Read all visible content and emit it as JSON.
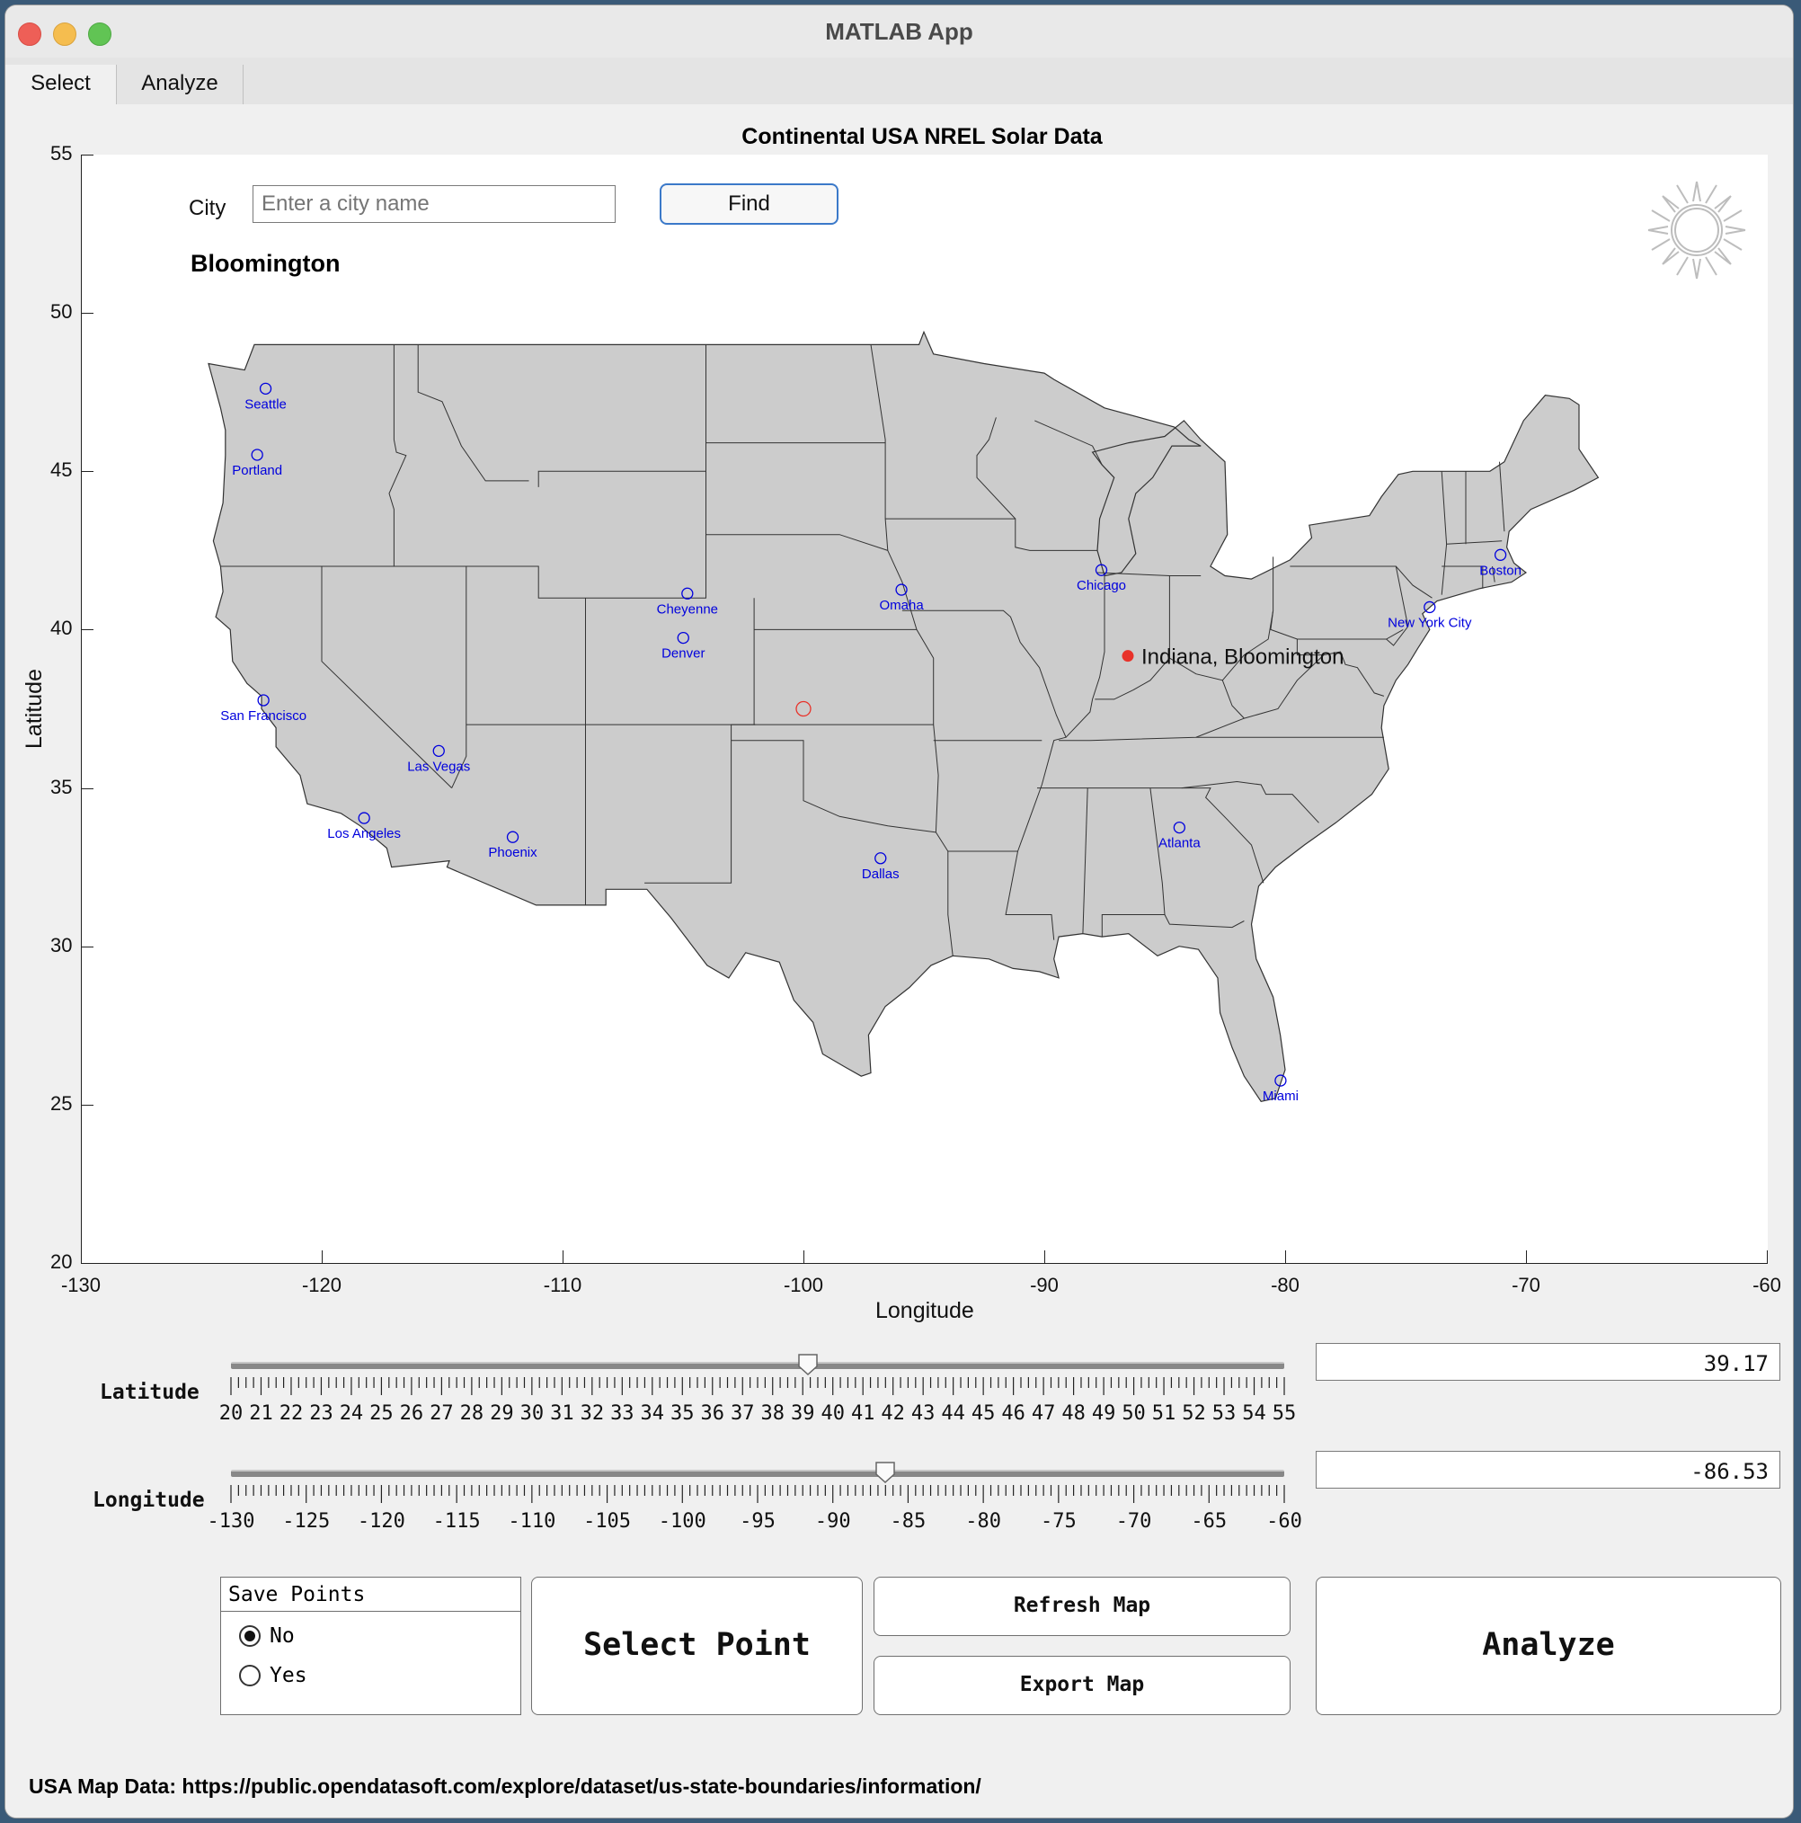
{
  "window": {
    "title": "MATLAB App"
  },
  "tabs": [
    {
      "label": "Select",
      "active": true
    },
    {
      "label": "Analyze",
      "active": false
    }
  ],
  "chart_data": {
    "type": "scatter",
    "title": "Continental USA NREL Solar Data",
    "xlabel": "Longitude",
    "ylabel": "Latitude",
    "xlim": [
      -130,
      -60
    ],
    "ylim": [
      20,
      55
    ],
    "xticks": [
      "-130",
      "-120",
      "-110",
      "-100",
      "-90",
      "-80",
      "-70",
      "-60"
    ],
    "yticks": [
      "20",
      "25",
      "30",
      "35",
      "40",
      "45",
      "50",
      "55"
    ],
    "cities": [
      {
        "name": "Seattle",
        "lon": -122.33,
        "lat": 47.61
      },
      {
        "name": "Portland",
        "lon": -122.68,
        "lat": 45.52
      },
      {
        "name": "San Francisco",
        "lon": -122.42,
        "lat": 37.77
      },
      {
        "name": "Las Vegas",
        "lon": -115.14,
        "lat": 36.17
      },
      {
        "name": "Los Angeles",
        "lon": -118.24,
        "lat": 34.05
      },
      {
        "name": "Phoenix",
        "lon": -112.07,
        "lat": 33.45
      },
      {
        "name": "Cheyenne",
        "lon": -104.82,
        "lat": 41.14
      },
      {
        "name": "Denver",
        "lon": -104.99,
        "lat": 39.74
      },
      {
        "name": "Omaha",
        "lon": -95.93,
        "lat": 41.26
      },
      {
        "name": "Dallas",
        "lon": -96.8,
        "lat": 32.78
      },
      {
        "name": "Chicago",
        "lon": -87.63,
        "lat": 41.88
      },
      {
        "name": "Atlanta",
        "lon": -84.39,
        "lat": 33.75
      },
      {
        "name": "Miami",
        "lon": -80.19,
        "lat": 25.76
      },
      {
        "name": "New York City",
        "lon": -74.0,
        "lat": 40.71
      },
      {
        "name": "Boston",
        "lon": -71.06,
        "lat": 42.36
      }
    ],
    "selected_point": {
      "label": "Indiana, Bloomington",
      "lon": -86.53,
      "lat": 39.17,
      "color": "#e8322a"
    },
    "default_point": {
      "lon": -100,
      "lat": 37.5,
      "color": "#e8322a"
    },
    "city_marker_color": "#0000dd",
    "map_fill": "#cccccc"
  },
  "search": {
    "label": "City",
    "placeholder": "Enter a city name",
    "value": "",
    "button": "Find"
  },
  "selected_city": "Bloomington",
  "latitude_slider": {
    "label": "Latitude",
    "min": 20,
    "max": 55,
    "value": 39.17,
    "display": "39.17",
    "labels": [
      "20",
      "21",
      "22",
      "23",
      "24",
      "25",
      "26",
      "27",
      "28",
      "29",
      "30",
      "31",
      "32",
      "33",
      "34",
      "35",
      "36",
      "37",
      "38",
      "39",
      "40",
      "41",
      "42",
      "43",
      "44",
      "45",
      "46",
      "47",
      "48",
      "49",
      "50",
      "51",
      "52",
      "53",
      "54",
      "55"
    ]
  },
  "longitude_slider": {
    "label": "Longitude",
    "min": -130,
    "max": -60,
    "value": -86.53,
    "display": "-86.53",
    "labels": [
      "-130",
      "-125",
      "-120",
      "-115",
      "-110",
      "-105",
      "-100",
      "-95",
      "-90",
      "-85",
      "-80",
      "-75",
      "-70",
      "-65",
      "-60"
    ]
  },
  "save_points": {
    "title": "Save Points",
    "options": [
      "No",
      "Yes"
    ],
    "selected": "No"
  },
  "buttons": {
    "select_point": "Select Point",
    "refresh_map": "Refresh Map",
    "export_map": "Export Map",
    "analyze": "Analyze"
  },
  "footer": "USA Map Data: https://public.opendatasoft.com/explore/dataset/us-state-boundaries/information/"
}
